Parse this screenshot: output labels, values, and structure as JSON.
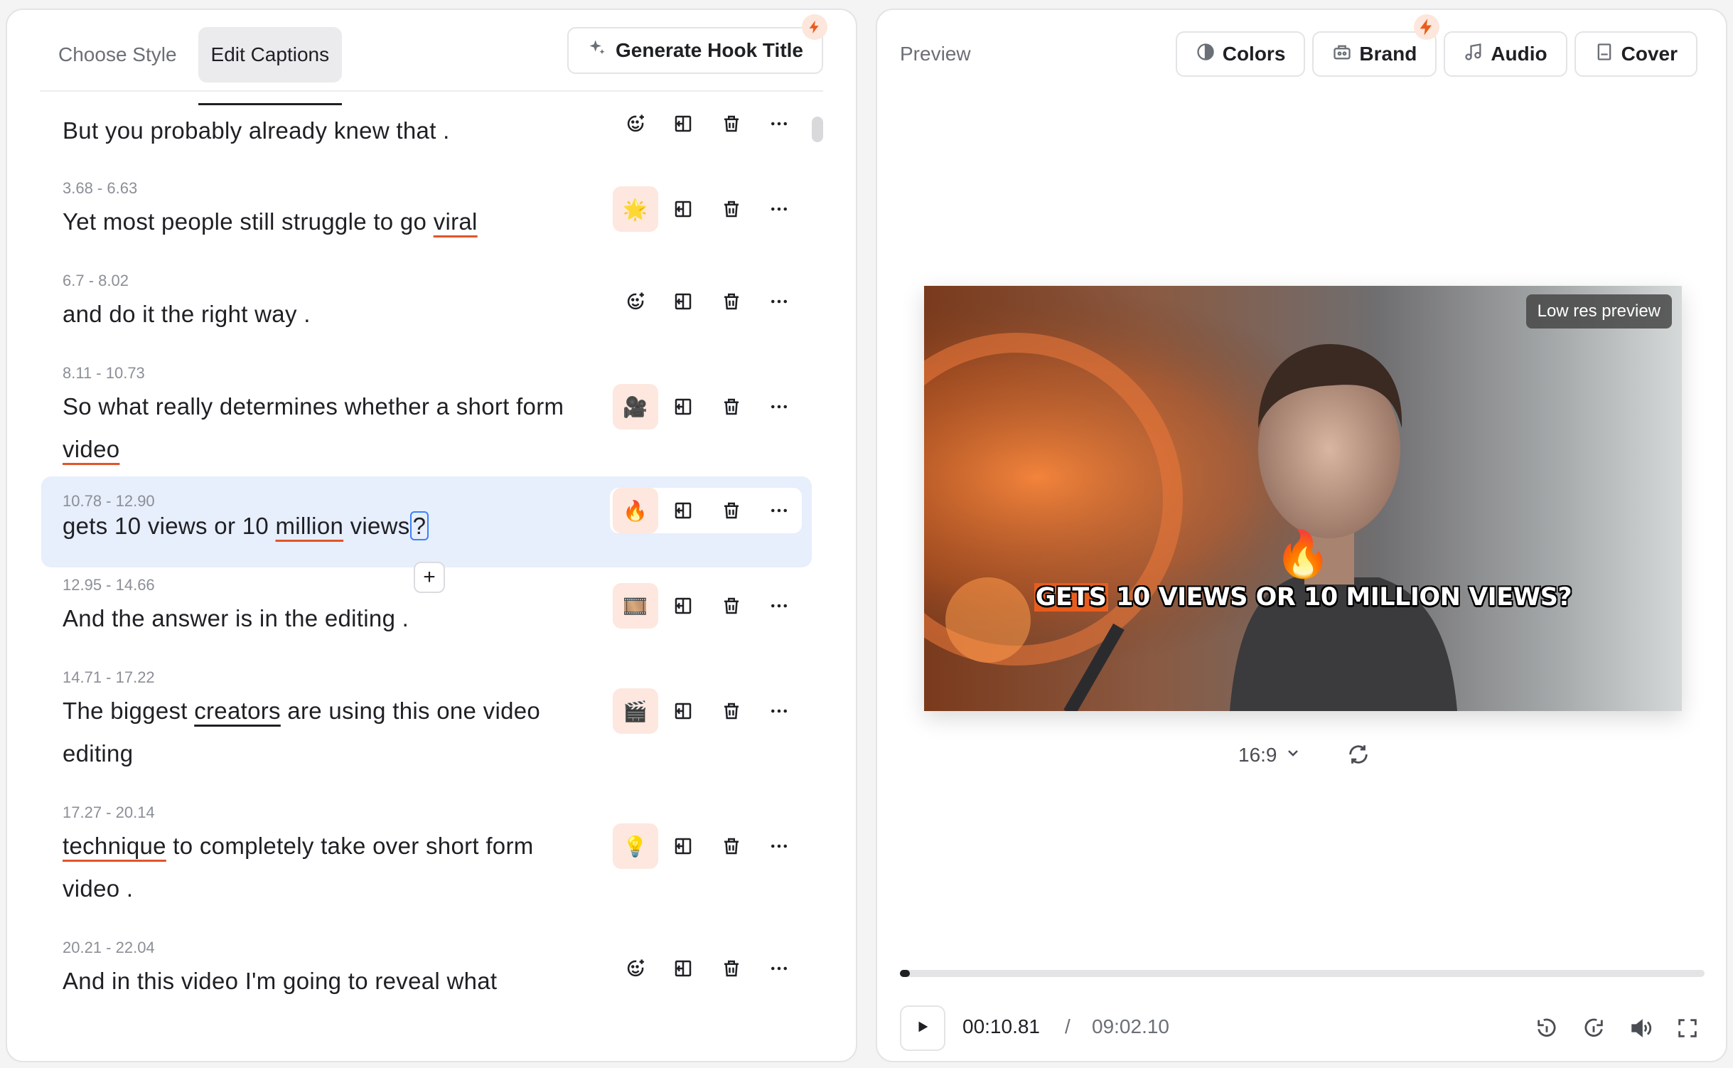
{
  "left_panel": {
    "tabs": [
      {
        "label": "Choose Style",
        "active": false
      },
      {
        "label": "Edit Captions",
        "active": true
      }
    ],
    "hook_button_label": "Generate Hook Title",
    "captions": [
      {
        "time": "",
        "parts": [
          {
            "t": "But you probably already knew that ."
          }
        ],
        "emoji": "",
        "emoji_button": "add-emoji-icon"
      },
      {
        "time": "3.68 - 6.63",
        "parts": [
          {
            "t": "Yet most people still struggle to go "
          },
          {
            "t": "viral",
            "u": "red"
          }
        ],
        "emoji": "🌟"
      },
      {
        "time": "6.7 - 8.02",
        "parts": [
          {
            "t": "and do it the right way ."
          }
        ],
        "emoji": "",
        "emoji_button": "add-emoji-icon"
      },
      {
        "time": "8.11 - 10.73",
        "parts": [
          {
            "t": "So what really determines whether a short form "
          },
          {
            "t": "video",
            "u": "red"
          }
        ],
        "emoji": "🎥"
      },
      {
        "time": "10.78 - 12.90",
        "parts": [
          {
            "t": "gets 10 views or 10 "
          },
          {
            "t": "million",
            "u": "red"
          },
          {
            "t": " views"
          },
          {
            "t": "?",
            "cursor": true
          }
        ],
        "emoji": "🔥",
        "selected": true
      },
      {
        "time": "12.95 - 14.66",
        "parts": [
          {
            "t": "And the answer is in the editing ."
          }
        ],
        "emoji": "🎞️"
      },
      {
        "time": "14.71 - 17.22",
        "parts": [
          {
            "t": "The biggest "
          },
          {
            "t": "creators",
            "u": "black"
          },
          {
            "t": " are using this one video editing"
          }
        ],
        "emoji": "🎬"
      },
      {
        "time": "17.27 - 20.14",
        "parts": [
          {
            "t": "technique",
            "u": "red"
          },
          {
            "t": " to completely take over short form video ."
          }
        ],
        "emoji": "💡"
      },
      {
        "time": "20.21 - 22.04",
        "parts": [
          {
            "t": "And in this video I'm going to reveal what"
          }
        ],
        "emoji": "",
        "emoji_button": "add-emoji-icon"
      }
    ],
    "insert_symbol": "+"
  },
  "right_panel": {
    "title": "Preview",
    "buttons": [
      {
        "label": "Colors",
        "icon": "contrast-icon"
      },
      {
        "label": "Brand",
        "icon": "brand-kit-icon",
        "bolt": true
      },
      {
        "label": "Audio",
        "icon": "music-note-icon"
      },
      {
        "label": "Cover",
        "icon": "cover-icon"
      }
    ],
    "video": {
      "badge": "Low res preview",
      "caption_emoji": "🔥",
      "caption_highlight": "GETS",
      "caption_rest": " 10 VIEWS OR 10 MILLION VIEWS?"
    },
    "aspect_ratio": "16:9",
    "player": {
      "current_time": "00:10.81",
      "separator": "/",
      "total_time": "09:02.10",
      "progress": 0.012
    }
  },
  "colors": {
    "accent": "#e85d1e",
    "selected_row": "#e7eefc",
    "emoji_bg": "#fde7de"
  }
}
